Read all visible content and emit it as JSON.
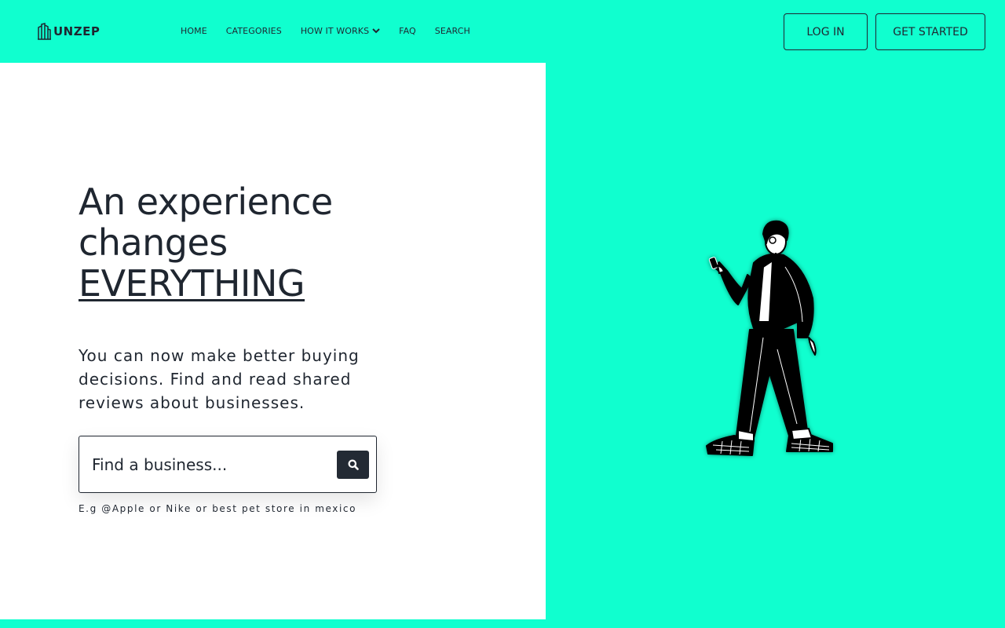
{
  "brand": {
    "name": "UNZEP",
    "logo_icon": "building-icon"
  },
  "nav": {
    "items": [
      {
        "label": "HOME"
      },
      {
        "label": "CATEGORIES"
      },
      {
        "label": "HOW IT WORKS",
        "icon": "chevron-down-icon"
      },
      {
        "label": "FAQ"
      },
      {
        "label": "SEARCH"
      }
    ]
  },
  "auth": {
    "login_label": "LOG IN",
    "get_started_label": "GET STARTED"
  },
  "hero": {
    "headline_line1": "An experience",
    "headline_line2": "changes",
    "headline_emphasis": "EVERYTHING",
    "subtext": "You can now make better buying decisions. Find and read shared reviews about businesses.",
    "search_placeholder": "Find a business...",
    "search_icon": "search-icon",
    "hint": "E.g @Apple or Nike or best pet store in mexico"
  },
  "colors": {
    "accent": "#10ffcf",
    "text": "#1f2630",
    "panel": "#ffffff",
    "button_dark": "#232a34"
  }
}
